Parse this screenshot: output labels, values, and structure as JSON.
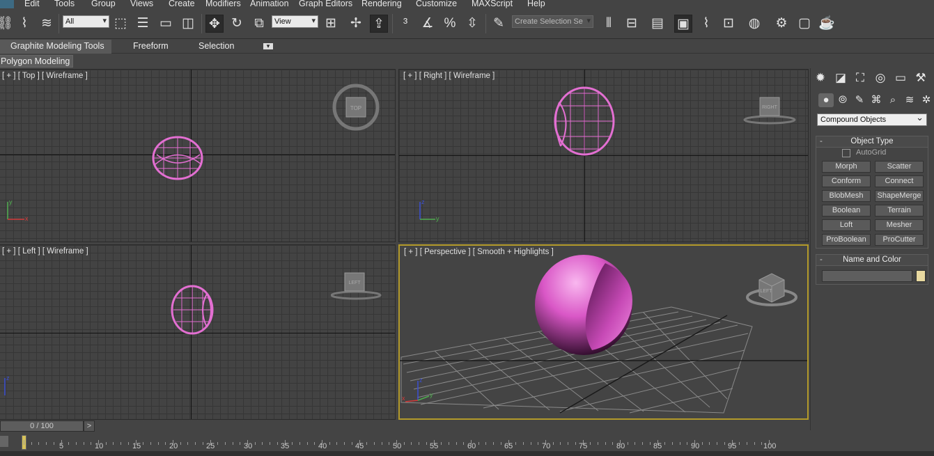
{
  "menu": [
    "Edit",
    "Tools",
    "Group",
    "Views",
    "Create",
    "Modifiers",
    "Animation",
    "Graph Editors",
    "Rendering",
    "Customize",
    "MAXScript",
    "Help"
  ],
  "toolbar": {
    "selection_filter": "All",
    "reference_coord": "View",
    "named_selection_placeholder": "Create Selection Se",
    "icons": [
      "link-icon",
      "unlink-icon",
      "bind-space-warp-icon",
      "select-object-icon",
      "select-by-name-icon",
      "rect-region-icon",
      "window-crossing-icon",
      "select-move-icon",
      "select-rotate-icon",
      "select-scale-icon",
      "pivot-icon",
      "manipulate-icon",
      "snap-3d-icon",
      "angle-snap-icon",
      "percent-snap-icon",
      "spinner-snap-icon",
      "edit-named-selection-icon",
      "mirror-icon",
      "align-icon",
      "layer-manager-icon",
      "scene-explorer-icon",
      "curve-editor-icon",
      "schematic-view-icon",
      "material-editor-icon",
      "render-setup-icon",
      "rendered-frame-icon",
      "render-icon"
    ]
  },
  "ribbon": {
    "tabs": [
      "Graphite Modeling Tools",
      "Freeform",
      "Selection"
    ],
    "sub_label": "Polygon Modeling"
  },
  "viewports": {
    "top": {
      "label": "[ + ] [ Top ] [ Wireframe ]",
      "gizmo": "TOP"
    },
    "right": {
      "label": "[ + ] [ Right ] [ Wireframe ]",
      "gizmo": "RIGHT"
    },
    "left": {
      "label": "[ + ] [ Left ] [ Wireframe ]",
      "gizmo": "LEFT"
    },
    "perspective": {
      "label": "[ + ] [ Perspective ] [ Smooth + Highlights ]",
      "gizmo": "LEFT"
    }
  },
  "axes": {
    "x": "x",
    "y": "y",
    "z": "z"
  },
  "command_panel": {
    "category": "Compound Objects",
    "object_type": {
      "title": "Object Type",
      "autogrid": "AutoGrid",
      "buttons": [
        "Morph",
        "Scatter",
        "Conform",
        "Connect",
        "BlobMesh",
        "ShapeMerge",
        "Boolean",
        "Terrain",
        "Loft",
        "Mesher",
        "ProBoolean",
        "ProCutter"
      ]
    },
    "name_color": {
      "title": "Name and Color",
      "name_value": ""
    },
    "object_color": "#e8d9a0"
  },
  "timeline": {
    "frame_display": "0 / 100",
    "next_label": ">",
    "ticks": [
      5,
      10,
      15,
      20,
      25,
      30,
      35,
      40,
      45,
      50,
      55,
      60,
      65,
      70,
      75,
      80,
      85,
      90,
      95,
      100
    ]
  },
  "colors": {
    "object": "#e36fd2",
    "viewport_border_active": "#b39a2a"
  }
}
